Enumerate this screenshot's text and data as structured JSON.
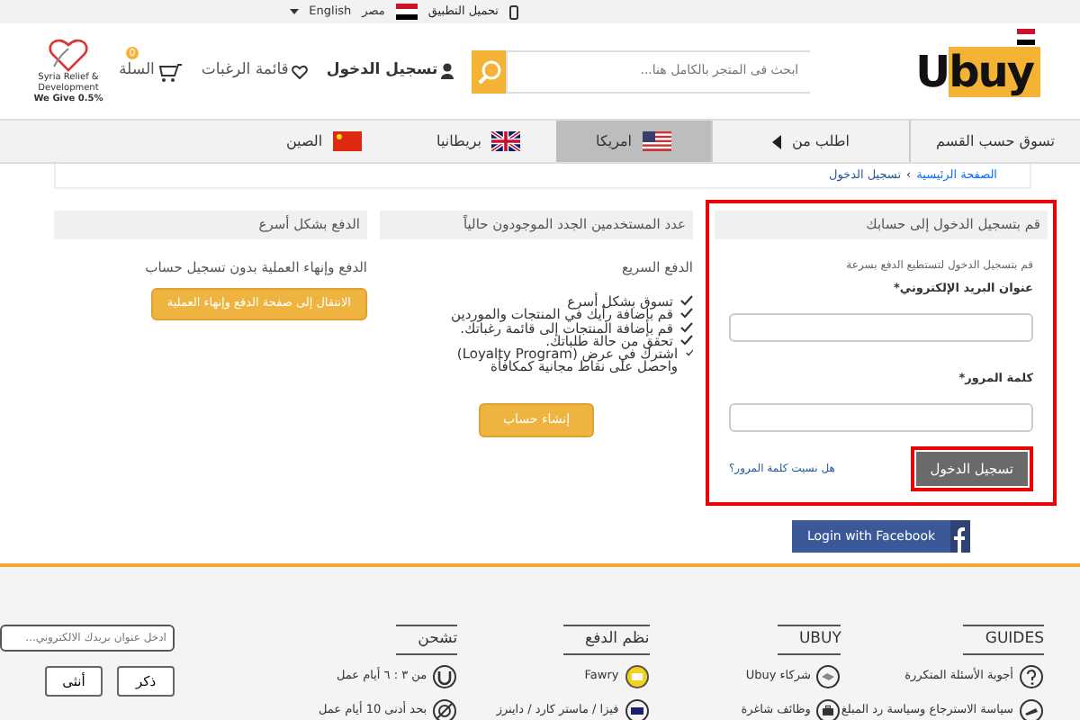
{
  "topbar": {
    "app_download": "تحميل التطبيق",
    "country": "مصر",
    "language": "English"
  },
  "header": {
    "logo": "Ubuy",
    "search_placeholder": "ابحث فى المتجر بالكامل هنا...",
    "account": "تسجيل الدخول",
    "wishlist": "قائمة الرغبات",
    "cart": "السلة",
    "cart_count": "0",
    "charity_name": "Syria Relief & Development",
    "charity_slogan": "We Give 0.5%"
  },
  "nav": [
    {
      "label": "تسوق حسب القسم",
      "kind": "menu",
      "selected": false
    },
    {
      "label": "اطلب من",
      "kind": "caret",
      "selected": false
    },
    {
      "label": "امريكا",
      "kind": "country",
      "selected": true
    },
    {
      "label": "بريطانيا",
      "kind": "country",
      "selected": false
    },
    {
      "label": "الصين",
      "kind": "country",
      "selected": false
    }
  ],
  "breadcrumb": [
    "الصفحة الرئيسية",
    "تسجيل الدخول"
  ],
  "breadcrumb_separator": "›",
  "login": {
    "title": "قم بتسجيل الدخول إلى حسابك",
    "intro": "قم بتسجيل الدخول لتستطيع الدفع بسرعة",
    "email_label": "عنوان البريد الإلكتروني*",
    "password_label": "كلمة المرور*",
    "forgot": "هل نسيت كلمة المرور؟",
    "submit": "تسجيل الدخول",
    "highlighted": true,
    "facebook": "Login with Facebook"
  },
  "new_users": {
    "title": "عدد المستخدمين الجدد الموجودون حالياً",
    "subtitle": "الدفع السريع",
    "benefits": [
      "تسوق بشكل أسرع",
      "قم بإضافة رأيك في المنتجات والموردين",
      "قم بإضافة المنتجات إلى قائمة رغباتك.",
      "تحقق من حالة طلباتك.",
      "اشترك في عرض (Loyalty Program) واحصل على نقاط مجانية كمكافأة"
    ],
    "button": "إنشاء حساب"
  },
  "guest": {
    "title": "الدفع بشكل أسرع",
    "text": "الدفع وإنهاء العملية بدون تسجيل حساب",
    "button": "الانتقال إلى صفحة الدفع وإنهاء العملية"
  },
  "footer": {
    "columns": [
      {
        "title": "GUIDES",
        "links": [
          "أجوبة الأسئلة المتكررة",
          "سياسة الاسترجاع وسياسة رد المبلغ"
        ]
      },
      {
        "title": "UBUY",
        "links": [
          "شركاء Ubuy",
          "وظائف شاغرة"
        ]
      },
      {
        "title": "نظم الدفع",
        "links": [
          "Fawry",
          "فيزا / ماستر كارد / داينرز"
        ]
      },
      {
        "title": "تشحن",
        "links": [
          "من ٣ : ٦ أيام عمل",
          "بحد أدنى 10 أيام عمل"
        ]
      }
    ],
    "newsletter_placeholder": "ادخل عنوان بريدك الالكتروني...",
    "gender_buttons": [
      "ذكر",
      "أنثى"
    ]
  }
}
